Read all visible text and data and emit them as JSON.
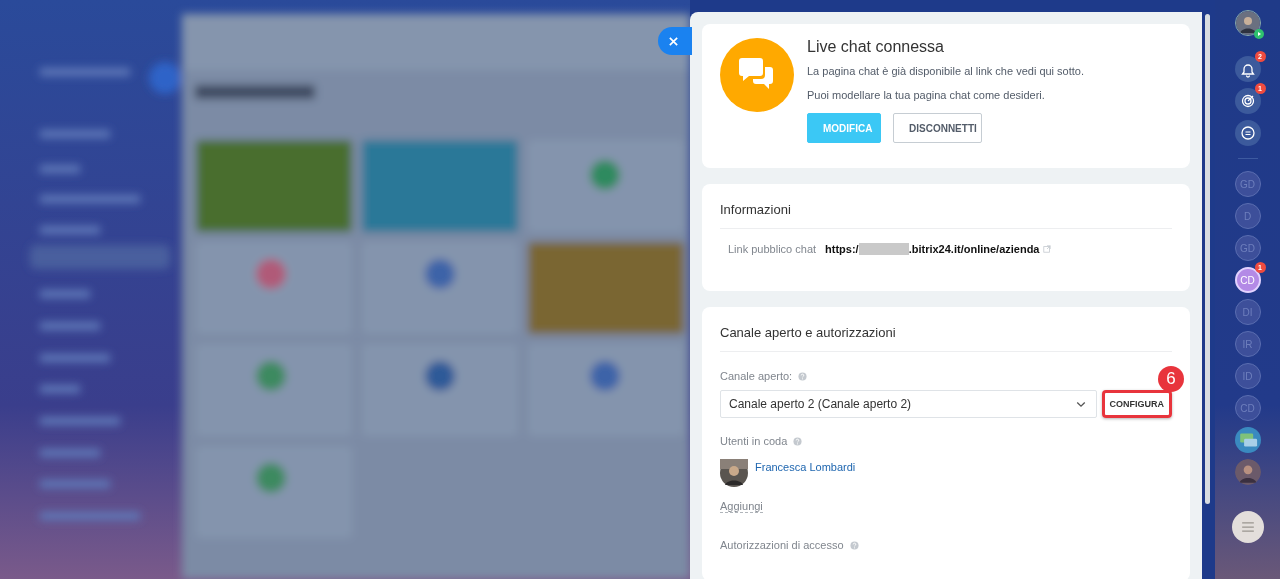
{
  "header_card": {
    "title": "Live chat connessa",
    "lines": [
      "La pagina chat è già disponibile al link che vedi qui sotto.",
      "Puoi modellare la tua pagina chat come desideri."
    ],
    "buttons": [
      {
        "label": "MODIFICA",
        "kind": "primary"
      },
      {
        "label": "DISCONNETTI",
        "kind": "secondary"
      }
    ]
  },
  "info_card": {
    "title": "Informazioni",
    "link_label": "Link pubblico chat",
    "link_parts": [
      "https:/",
      ".bitrix24.it/online/azienda"
    ],
    "redacted": true
  },
  "channel_card": {
    "title": "Canale aperto e autorizzazioni",
    "channel_label": "Canale aperto:",
    "channel_value": "Canale aperto 2 (Canale aperto 2)",
    "configure_button": "CONFIGURA",
    "annotation": "6",
    "queue_label": "Utenti in coda",
    "users": [
      {
        "name": "Francesca Lombardi"
      }
    ],
    "add_link": "Aggiungi",
    "permissions_label": "Autorizzazioni di accesso"
  },
  "right_bar": [
    {
      "kind": "user"
    },
    {
      "kind": "bell",
      "badge": "2"
    },
    {
      "kind": "target",
      "badge": "1"
    },
    {
      "kind": "chats"
    },
    {
      "kind": "divider"
    },
    {
      "kind": "initials",
      "text": "GD",
      "selected": false
    },
    {
      "kind": "initials",
      "text": "D",
      "selected": false
    },
    {
      "kind": "initials",
      "text": "GD",
      "selected": false
    },
    {
      "kind": "initials",
      "text": "CD",
      "selected": true,
      "badge": "1"
    },
    {
      "kind": "initials",
      "text": "DI",
      "selected": false
    },
    {
      "kind": "initials",
      "text": "IR",
      "selected": false
    },
    {
      "kind": "initials",
      "text": "ID",
      "selected": false
    },
    {
      "kind": "initials",
      "text": "CD",
      "selected": false
    },
    {
      "kind": "chat"
    },
    {
      "kind": "photo"
    },
    {
      "kind": "menu"
    }
  ]
}
